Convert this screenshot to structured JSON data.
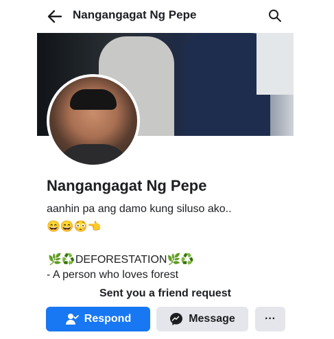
{
  "header": {
    "title": "Nangangagat Ng Pepe",
    "back_icon": "arrow-left-icon",
    "search_icon": "search-icon"
  },
  "profile": {
    "name": "Nangangagat Ng Pepe",
    "bio": "aanhin pa ang damo kung siluso ako..",
    "bio_emojis": "😄😄😳👈",
    "intro_prefix": "🌿♻️",
    "intro_word": "DEFORESTATION",
    "intro_suffix": "🌿♻️",
    "description": "- A person who loves forest"
  },
  "request": {
    "text": "Sent you a friend request"
  },
  "actions": {
    "respond_label": "Respond",
    "message_label": "Message",
    "more_label": "···"
  },
  "colors": {
    "primary": "#1877f2",
    "secondary_bg": "#e4e6eb"
  }
}
